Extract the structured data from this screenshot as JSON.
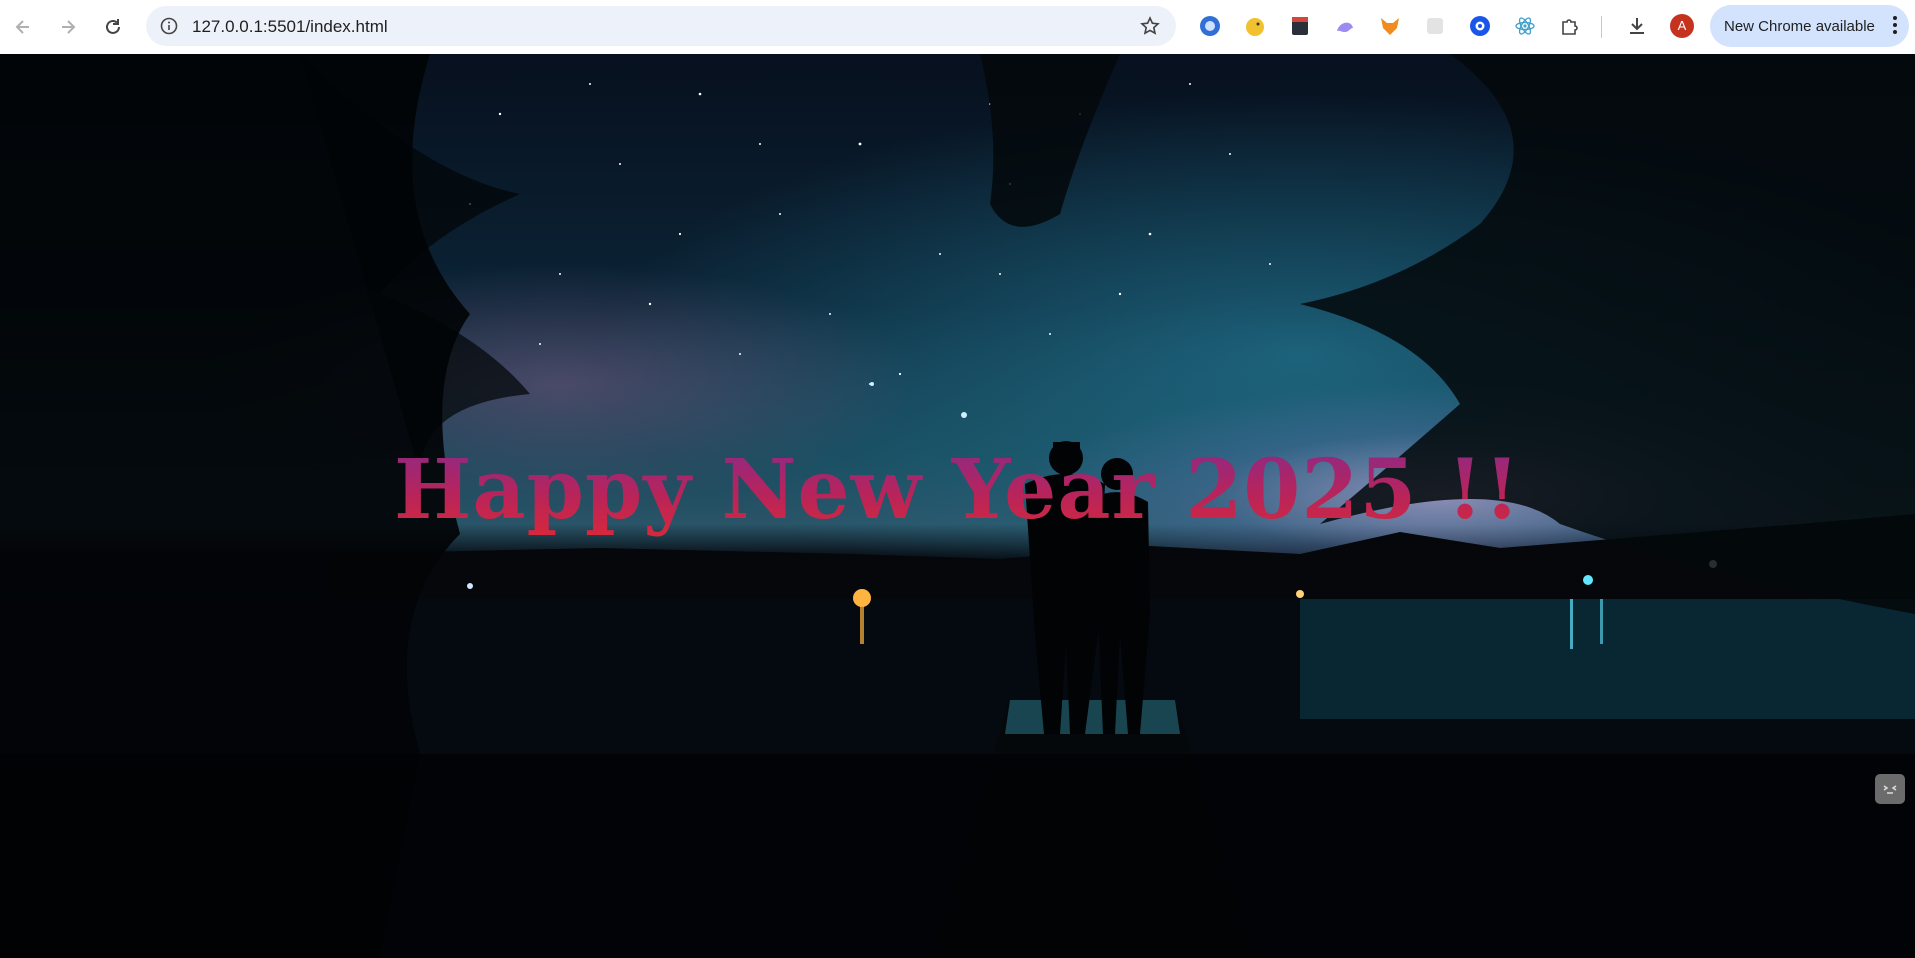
{
  "browser": {
    "url": "127.0.0.1:5501/index.html",
    "update_label": "New Chrome available",
    "profile_initial": "A",
    "extensions": [
      "blue-circle-extension",
      "yellow-duck-extension",
      "dark-book-extension",
      "ghost-extension",
      "fox-extension",
      "gray-extension",
      "blue-ring-extension",
      "react-extension"
    ],
    "colors": {
      "omnibox": "#edf2fa",
      "update_chip": "#d3e3fd",
      "profile": "#c5321e"
    }
  },
  "page": {
    "heading": "Happy New Year 2025 !!",
    "heading_colors": [
      "#8a2a8a",
      "#d8283a"
    ],
    "background": "starry night lake with couple on pier"
  }
}
